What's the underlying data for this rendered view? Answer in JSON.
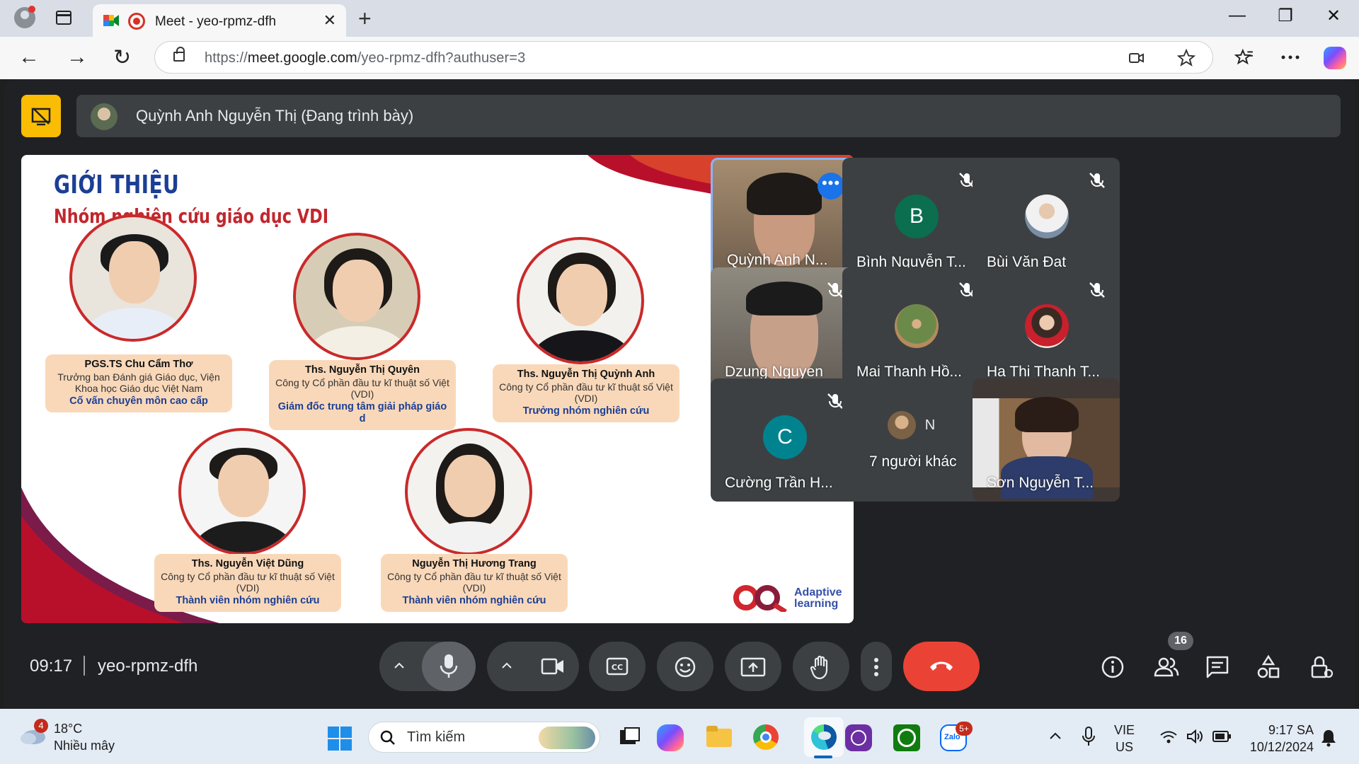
{
  "browser": {
    "tab_title": "Meet - yeo-rpmz-dfh",
    "tab_close": "✕",
    "new_tab": "+",
    "url_prefix": "https://",
    "url_domain": "meet.google.com",
    "url_path": "/yeo-rpmz-dfh?authuser=3",
    "back": "←",
    "forward": "→",
    "reload": "↻",
    "minimize": "—",
    "restore": "❐",
    "close": "✕",
    "icons": [
      "profile-icon",
      "tab-actions-icon",
      "meet-favicon",
      "recording-icon",
      "lock-icon",
      "camera-blocked-icon",
      "star-icon",
      "favorites-icon",
      "more-icon",
      "copilot-icon"
    ]
  },
  "meet": {
    "presenter_label": "Quỳnh Anh Nguyễn Thị (Đang trình bày)",
    "time": "09:17",
    "meeting_code": "yeo-rpmz-dfh",
    "people_count": "16",
    "accent": "#1a73e8",
    "end_call_color": "#ea4335"
  },
  "slide": {
    "title": "GIỚI THIỆU",
    "subtitle": "Nhóm nghiên cứu giáo dục VDI",
    "members": [
      {
        "name": "PGS.TS Chu Cẩm Thơ",
        "org": "Trưởng ban Đánh giá Giáo dục, Viện Khoa học Giáo dục Việt Nam",
        "role": "Cố vấn chuyên môn cao cấp"
      },
      {
        "name": "Ths. Nguyễn Thị Quyên",
        "org": "Công ty Cổ phần đầu tư kĩ thuật số Việt (VDI)",
        "role": "Giám đốc trung tâm giải pháp giáo d"
      },
      {
        "name": "Ths. Nguyễn Thị Quỳnh Anh",
        "org": "Công ty Cổ phần đầu tư kĩ thuật số Việt (VDI)",
        "role": "Trưởng nhóm nghiên cứu"
      },
      {
        "name": "Ths. Nguyễn Việt Dũng",
        "org": "Công ty Cổ phần đầu tư kĩ thuật số Việt (VDI)",
        "role": "Thành viên nhóm nghiên cứu"
      },
      {
        "name": "Nguyễn Thị Hương Trang",
        "org": "Công ty Cổ phần đầu tư kĩ thuật số Việt (VDI)",
        "role": "Thành viên nhóm nghiên cứu"
      }
    ],
    "brand_line1": "Adaptive",
    "brand_line2": "learning"
  },
  "participants": [
    {
      "name": "Quỳnh Anh N...",
      "type": "video",
      "muted": false
    },
    {
      "name": "Bình Nguyễn T...",
      "type": "initial",
      "initial": "B",
      "color": "#0b6e4f",
      "muted": true
    },
    {
      "name": "Bùi Văn Đạt",
      "type": "photo",
      "muted": true
    },
    {
      "name": "Dzung Nguyen",
      "type": "video",
      "muted": true
    },
    {
      "name": "Mai Thanh Hồ...",
      "type": "photo",
      "muted": true
    },
    {
      "name": "Ha Thi Thanh T...",
      "type": "photo",
      "muted": true
    },
    {
      "name": "Cường Trần H...",
      "type": "initial",
      "initial": "C",
      "color": "#00838f",
      "muted": true
    },
    {
      "name": "7 người khác",
      "type": "others",
      "initial": "N"
    },
    {
      "name": "Sơn Nguyễn T...",
      "type": "video",
      "muted": false
    }
  ],
  "taskbar": {
    "weather_badge": "4",
    "temperature": "18°C",
    "condition": "Nhiều mây",
    "search_placeholder": "Tìm kiếm",
    "zalo_badge": "5+",
    "lang_line1": "VIE",
    "lang_line2": "US",
    "time": "9:17 SA",
    "date": "10/12/2024"
  }
}
